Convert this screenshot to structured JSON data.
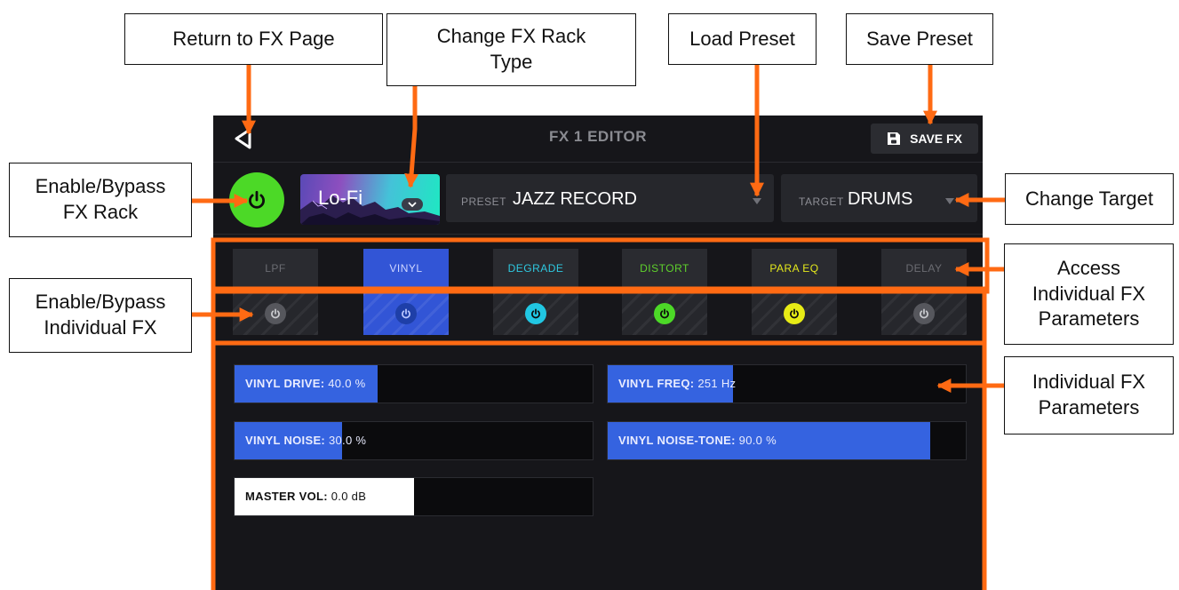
{
  "annotations": {
    "return_fx_page": "Return to FX Page",
    "change_rack_type": "Change FX Rack\nType",
    "load_preset": "Load Preset",
    "save_preset": "Save Preset",
    "enable_rack": "Enable/Bypass\nFX Rack",
    "change_target": "Change Target",
    "enable_individual": "Enable/Bypass\nIndividual FX",
    "access_params": "Access\nIndividual FX\nParameters",
    "individual_params": "Individual FX\nParameters",
    "accent_color": "#ff6a13"
  },
  "editor": {
    "title": "FX 1 EDITOR",
    "save_label": "SAVE FX",
    "rack_type": "Lo-Fi",
    "preset_label": "PRESET",
    "preset_value": "JAZZ RECORD",
    "target_label": "TARGET",
    "target_value": "DRUMS",
    "power_color": "#4cd927"
  },
  "effects": [
    {
      "name": "LPF",
      "label_color": "#6b6c72",
      "enabled": false,
      "selected": false,
      "power_color": "#56575d"
    },
    {
      "name": "VINYL",
      "label_color": "#cfd6ff",
      "enabled": false,
      "selected": true,
      "power_color": "#1e3fa8"
    },
    {
      "name": "DEGRADE",
      "label_color": "#2ec8e0",
      "enabled": true,
      "selected": false,
      "power_color": "#21c7e3"
    },
    {
      "name": "DISTORT",
      "label_color": "#5fd12c",
      "enabled": true,
      "selected": false,
      "power_color": "#4cd927"
    },
    {
      "name": "PARA EQ",
      "label_color": "#e4e91c",
      "enabled": true,
      "selected": false,
      "power_color": "#e7ec16"
    },
    {
      "name": "DELAY",
      "label_color": "#6b6c72",
      "enabled": false,
      "selected": false,
      "power_color": "#56575d"
    }
  ],
  "params": [
    {
      "name": "VINYL DRIVE:",
      "value": "40.0 %",
      "fraction": 0.4,
      "color": "#3563e0"
    },
    {
      "name": "VINYL FREQ:",
      "value": "251 Hz",
      "fraction": 0.35,
      "color": "#3563e0"
    },
    {
      "name": "VINYL NOISE:",
      "value": "30.0 %",
      "fraction": 0.3,
      "color": "#3563e0"
    },
    {
      "name": "VINYL NOISE-TONE:",
      "value": "90.0 %",
      "fraction": 0.9,
      "color": "#3563e0"
    },
    {
      "name": "MASTER VOL:",
      "value": "0.0 dB",
      "fraction": 0.5,
      "color": "#ffffff"
    }
  ]
}
